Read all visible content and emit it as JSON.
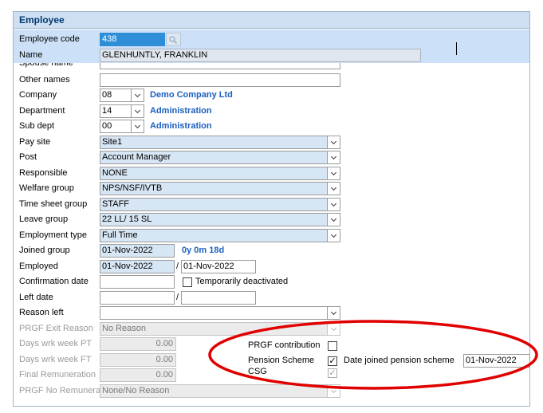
{
  "window": {
    "title": "Employee"
  },
  "employee_code": {
    "label": "Employee code",
    "value": "438",
    "lookup_icon": "magnifier-icon"
  },
  "name": {
    "label": "Name",
    "value": "GLENHUNTLY, FRANKLIN"
  },
  "spouse_name": {
    "label": "Spouse name",
    "value": ""
  },
  "other_names": {
    "label": "Other names",
    "value": ""
  },
  "company": {
    "label": "Company",
    "code": "08",
    "description": "Demo Company Ltd"
  },
  "department": {
    "label": "Department",
    "code": "14",
    "description": "Administration"
  },
  "sub_dept": {
    "label": "Sub dept",
    "code": "00",
    "description": "Administration"
  },
  "pay_site": {
    "label": "Pay site",
    "value": "Site1"
  },
  "post": {
    "label": "Post",
    "value": "Account Manager"
  },
  "responsible": {
    "label": "Responsible",
    "value": "NONE"
  },
  "welfare_group": {
    "label": "Welfare group",
    "value": "NPS/NSF/IVTB"
  },
  "time_sheet_group": {
    "label": "Time sheet group",
    "value": "STAFF"
  },
  "leave_group": {
    "label": "Leave group",
    "value": "22 LL/ 15 SL"
  },
  "employment_type": {
    "label": "Employment type",
    "value": "Full Time"
  },
  "joined_group": {
    "label": "Joined group",
    "value": "01-Nov-2022",
    "duration": "0y 0m 18d"
  },
  "employed": {
    "label": "Employed",
    "value": "01-Nov-2022",
    "value2": "01-Nov-2022",
    "separator": "/"
  },
  "confirmation_date": {
    "label": "Confirmation date",
    "value": "",
    "deactivated_label": "Temporarily deactivated"
  },
  "left_date": {
    "label": "Left date",
    "value": "",
    "value2": "",
    "separator": "/"
  },
  "reason_left": {
    "label": "Reason left",
    "value": ""
  },
  "prgf_exit_reason": {
    "label": "PRGF Exit Reason",
    "value": "No Reason"
  },
  "days_wrk_week_pt": {
    "label": "Days wrk week PT",
    "value": "0.00"
  },
  "days_wrk_week_ft": {
    "label": "Days wrk week FT",
    "value": "0.00"
  },
  "final_remuneration": {
    "label": "Final Remuneration",
    "value": "0.00"
  },
  "prgf_no_remunera": {
    "label": "PRGF No Remunera",
    "value": "None/No Reason"
  },
  "prgf_contribution": {
    "label": "PRGF contribution",
    "checked": false
  },
  "pension_scheme": {
    "label": "Pension Scheme",
    "checked": true,
    "check_glyph": "✓"
  },
  "date_joined_pension": {
    "label": "Date joined pension scheme",
    "value": "01-Nov-2022"
  },
  "csg": {
    "label": "CSG",
    "checked": true
  },
  "annotation": {
    "shape": "ellipse",
    "color": "#e00000"
  }
}
